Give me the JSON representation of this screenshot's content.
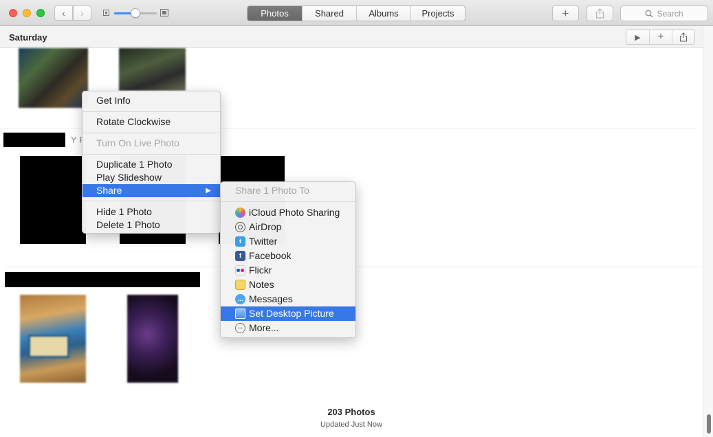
{
  "toolbar": {
    "nav_back_glyph": "‹",
    "nav_forward_glyph": "›",
    "tabs": [
      {
        "label": "Photos",
        "active": true
      },
      {
        "label": "Shared",
        "active": false
      },
      {
        "label": "Albums",
        "active": false
      },
      {
        "label": "Projects",
        "active": false
      }
    ],
    "add_glyph": "+",
    "search_placeholder": "Search",
    "zoom_level": 0.5
  },
  "section": {
    "title": "Saturday",
    "play_glyph": "▶",
    "add_glyph": "+"
  },
  "moment2_partial_text": "Y R",
  "footer": {
    "count": "203 Photos",
    "status": "Updated Just Now"
  },
  "context_menu": {
    "get_info": "Get Info",
    "rotate": "Rotate Clockwise",
    "live_photo": "Turn On Live Photo",
    "duplicate": "Duplicate 1 Photo",
    "slideshow": "Play Slideshow",
    "share": "Share",
    "share_arrow": "▶",
    "hide": "Hide 1 Photo",
    "delete": "Delete 1 Photo"
  },
  "share_menu": {
    "header": "Share 1 Photo To",
    "items": [
      {
        "label": "iCloud Photo Sharing",
        "icon": "icloud-photo-sharing-icon"
      },
      {
        "label": "AirDrop",
        "icon": "airdrop-icon"
      },
      {
        "label": "Twitter",
        "icon": "twitter-icon"
      },
      {
        "label": "Facebook",
        "icon": "facebook-icon"
      },
      {
        "label": "Flickr",
        "icon": "flickr-icon"
      },
      {
        "label": "Notes",
        "icon": "notes-icon"
      },
      {
        "label": "Messages",
        "icon": "messages-icon"
      },
      {
        "label": "Set Desktop Picture",
        "icon": "desktop-picture-icon",
        "selected": true
      },
      {
        "label": "More...",
        "icon": "more-icon"
      }
    ],
    "twitter_glyph": "t",
    "facebook_glyph": "f",
    "messages_glyph": "…",
    "more_glyph": "···"
  },
  "colors": {
    "accent": "#3877e6",
    "close": "#fc5f57",
    "minimize": "#fdbc2e",
    "maximize": "#29c940"
  }
}
